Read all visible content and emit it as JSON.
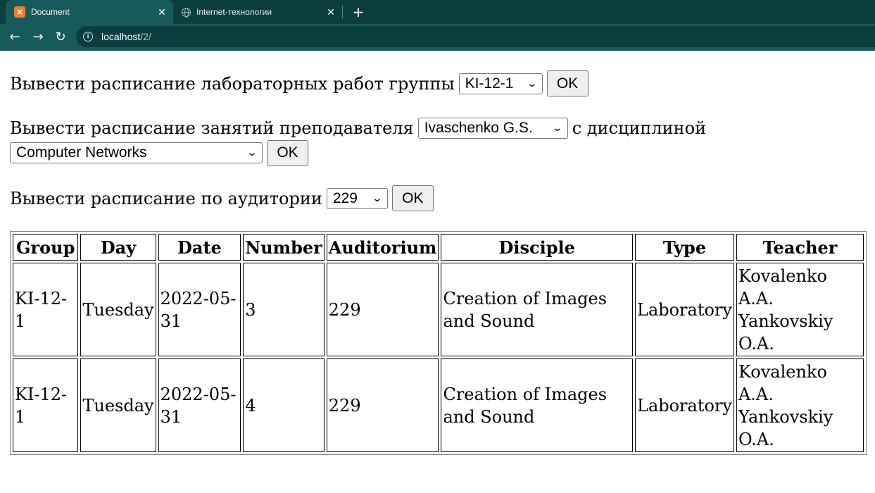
{
  "browser": {
    "tabs": [
      {
        "title": "Document",
        "active": true
      },
      {
        "title": "Internet-технологии",
        "active": false
      }
    ],
    "new_tab_label": "+",
    "address": {
      "host": "localhost",
      "path": "/2/"
    }
  },
  "forms": {
    "group_form": {
      "label": "Вывести расписание лабораторных работ группы",
      "selected": "KI-12-1",
      "button": "OK"
    },
    "teacher_form": {
      "label_before": "Вывести расписание занятий преподавателя",
      "teacher_selected": "Ivaschenko G.S.",
      "label_middle": "с дисциплиной",
      "discipline_selected": "Computer Networks",
      "button": "OK"
    },
    "auditorium_form": {
      "label": "Вывести расписание по аудитории",
      "selected": "229",
      "button": "OK"
    }
  },
  "table": {
    "headers": [
      "Group",
      "Day",
      "Date",
      "Number",
      "Auditorium",
      "Disciple",
      "Type",
      "Teacher"
    ],
    "rows": [
      [
        "KI-12-1",
        "Tuesday",
        "2022-05-31",
        "3",
        "229",
        "Creation of Images and Sound",
        "Laboratory",
        "Kovalenko A.A. Yankovskiy O.A."
      ],
      [
        "KI-12-1",
        "Tuesday",
        "2022-05-31",
        "4",
        "229",
        "Creation of Images and Sound",
        "Laboratory",
        "Kovalenko A.A. Yankovskiy O.A."
      ]
    ]
  }
}
